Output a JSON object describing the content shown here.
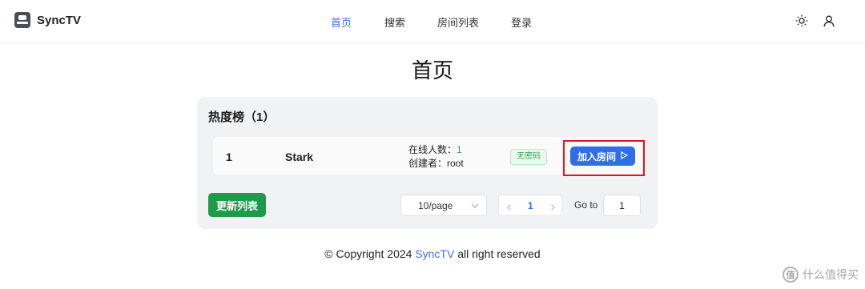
{
  "header": {
    "brand": "SyncTV",
    "nav": [
      {
        "label": "首页",
        "active": true
      },
      {
        "label": "搜索",
        "active": false
      },
      {
        "label": "房间列表",
        "active": false
      },
      {
        "label": "登录",
        "active": false
      }
    ],
    "icons": [
      "sun-icon",
      "user-icon"
    ]
  },
  "main": {
    "title": "首页",
    "hot_list": {
      "title": "热度榜（1）",
      "rooms": [
        {
          "rank": "1",
          "name": "Stark",
          "online_label": "在线人数：",
          "online_count": "1",
          "creator_label": "创建者：",
          "creator": "root",
          "badge": "无密码",
          "join_label": "加入房间",
          "join_icon": "play-icon"
        }
      ],
      "refresh_label": "更新列表",
      "pagination": {
        "page_size": "10/page",
        "current_page": "1",
        "goto_label": "Go to",
        "goto_value": "1"
      }
    }
  },
  "footer": {
    "prefix": "© Copyright 2024 ",
    "link": "SyncTV",
    "suffix": " all right reserved"
  },
  "watermark": {
    "icon_text": "值",
    "text": "什么值得买"
  },
  "colors": {
    "accent": "#3b6ef5",
    "primary_button": "#2f6ee8",
    "success_button": "#1f9a4b",
    "highlight_box": "#e8141b"
  }
}
